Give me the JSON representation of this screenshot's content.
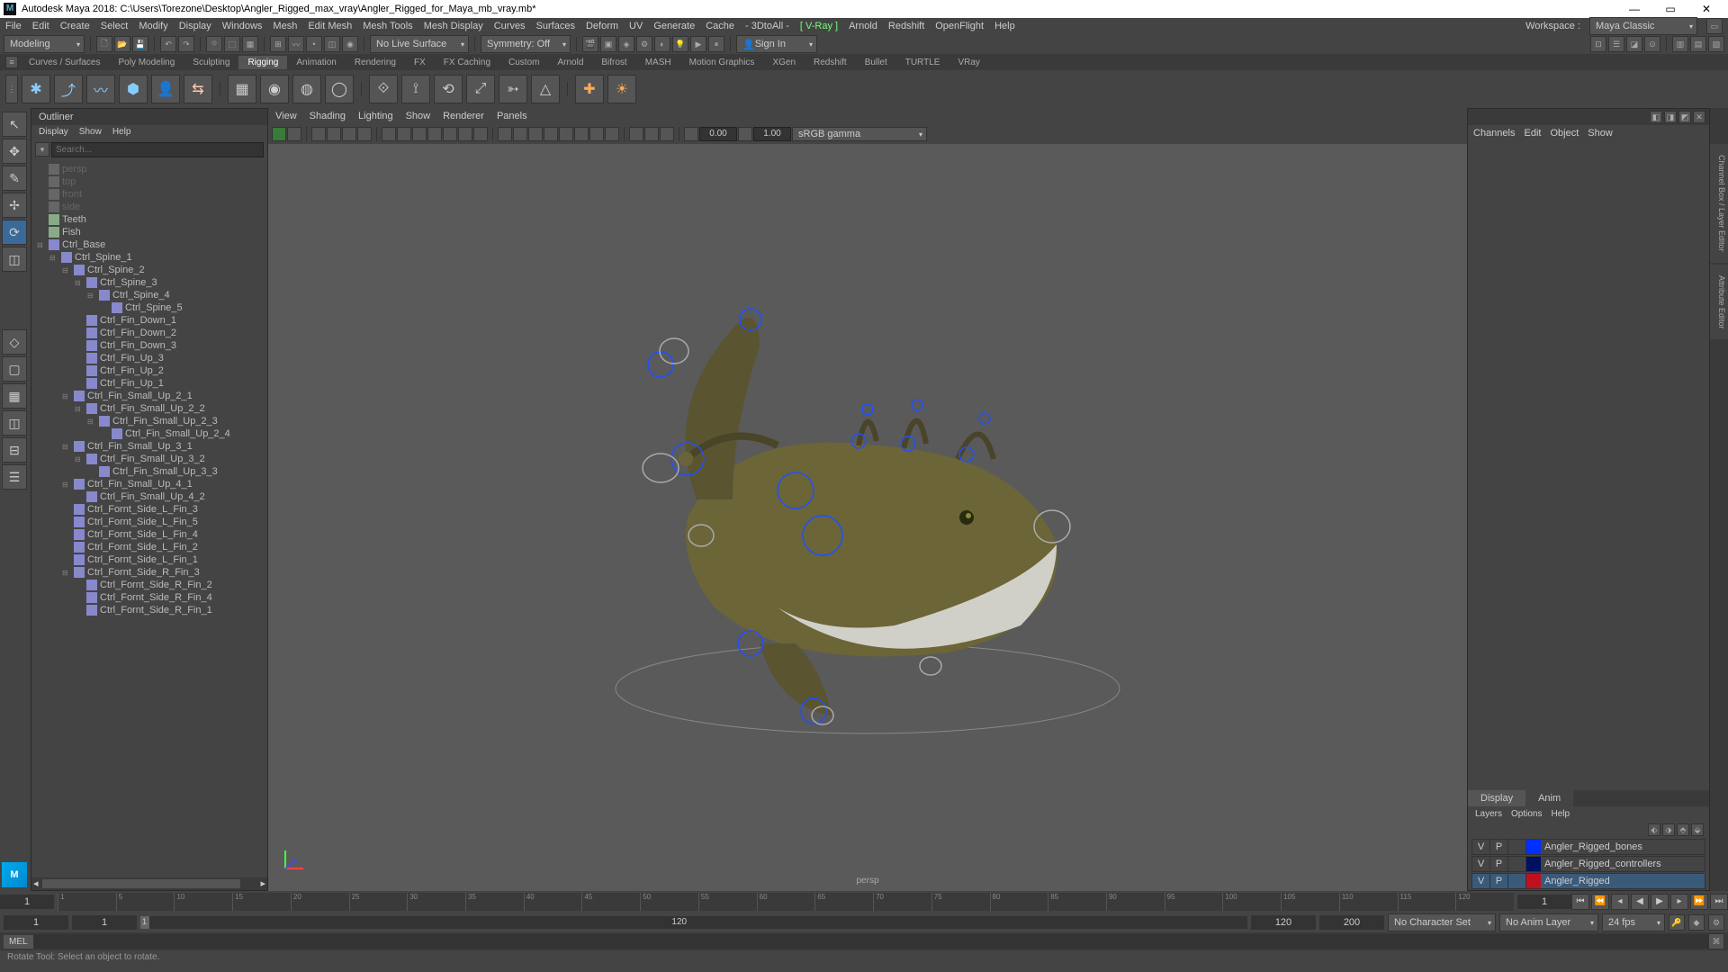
{
  "window": {
    "title": "Autodesk Maya 2018: C:\\Users\\Torezone\\Desktop\\Angler_Rigged_max_vray\\Angler_Rigged_for_Maya_mb_vray.mb*",
    "minimize": "—",
    "maximize": "▭",
    "close": "✕"
  },
  "menus": [
    "File",
    "Edit",
    "Create",
    "Select",
    "Modify",
    "Display",
    "Windows",
    "Mesh",
    "Edit Mesh",
    "Mesh Tools",
    "Mesh Display",
    "Curves",
    "Surfaces",
    "Deform",
    "UV",
    "Generate",
    "Cache",
    "- 3DtoAll -",
    "[ V-Ray ]",
    "Arnold",
    "Redshift",
    "OpenFlight",
    "Help"
  ],
  "workspace": {
    "label": "Workspace :",
    "value": "Maya Classic"
  },
  "statusline": {
    "menuset": "Modeling",
    "nolive": "No Live Surface",
    "symmetry": "Symmetry: Off",
    "signin": "Sign In"
  },
  "shelves": [
    "Curves / Surfaces",
    "Poly Modeling",
    "Sculpting",
    "Rigging",
    "Animation",
    "Rendering",
    "FX",
    "FX Caching",
    "Custom",
    "Arnold",
    "Bifrost",
    "MASH",
    "Motion Graphics",
    "XGen",
    "Redshift",
    "Bullet",
    "TURTLE",
    "VRay"
  ],
  "activeShelf": "Rigging",
  "outliner": {
    "title": "Outliner",
    "menus": [
      "Display",
      "Show",
      "Help"
    ],
    "search": "Search...",
    "items": [
      {
        "d": 0,
        "t": "c",
        "l": "persp",
        "dim": true
      },
      {
        "d": 0,
        "t": "c",
        "l": "top",
        "dim": true
      },
      {
        "d": 0,
        "t": "c",
        "l": "front",
        "dim": true
      },
      {
        "d": 0,
        "t": "c",
        "l": "side",
        "dim": true
      },
      {
        "d": 0,
        "t": "m",
        "l": "Teeth"
      },
      {
        "d": 0,
        "t": "m",
        "l": "Fish"
      },
      {
        "d": 0,
        "t": "x",
        "l": "Ctrl_Base",
        "exp": true
      },
      {
        "d": 1,
        "t": "x",
        "l": "Ctrl_Spine_1",
        "exp": true
      },
      {
        "d": 2,
        "t": "x",
        "l": "Ctrl_Spine_2",
        "exp": true
      },
      {
        "d": 3,
        "t": "x",
        "l": "Ctrl_Spine_3",
        "exp": true
      },
      {
        "d": 4,
        "t": "x",
        "l": "Ctrl_Spine_4",
        "exp": true
      },
      {
        "d": 5,
        "t": "x",
        "l": "Ctrl_Spine_5"
      },
      {
        "d": 3,
        "t": "x",
        "l": "Ctrl_Fin_Down_1"
      },
      {
        "d": 3,
        "t": "x",
        "l": "Ctrl_Fin_Down_2"
      },
      {
        "d": 3,
        "t": "x",
        "l": "Ctrl_Fin_Down_3"
      },
      {
        "d": 3,
        "t": "x",
        "l": "Ctrl_Fin_Up_3"
      },
      {
        "d": 3,
        "t": "x",
        "l": "Ctrl_Fin_Up_2"
      },
      {
        "d": 3,
        "t": "x",
        "l": "Ctrl_Fin_Up_1"
      },
      {
        "d": 2,
        "t": "x",
        "l": "Ctrl_Fin_Small_Up_2_1",
        "exp": true
      },
      {
        "d": 3,
        "t": "x",
        "l": "Ctrl_Fin_Small_Up_2_2",
        "exp": true
      },
      {
        "d": 4,
        "t": "x",
        "l": "Ctrl_Fin_Small_Up_2_3",
        "exp": true
      },
      {
        "d": 5,
        "t": "x",
        "l": "Ctrl_Fin_Small_Up_2_4"
      },
      {
        "d": 2,
        "t": "x",
        "l": "Ctrl_Fin_Small_Up_3_1",
        "exp": true
      },
      {
        "d": 3,
        "t": "x",
        "l": "Ctrl_Fin_Small_Up_3_2",
        "exp": true
      },
      {
        "d": 4,
        "t": "x",
        "l": "Ctrl_Fin_Small_Up_3_3"
      },
      {
        "d": 2,
        "t": "x",
        "l": "Ctrl_Fin_Small_Up_4_1",
        "exp": true
      },
      {
        "d": 3,
        "t": "x",
        "l": "Ctrl_Fin_Small_Up_4_2"
      },
      {
        "d": 2,
        "t": "x",
        "l": "Ctrl_Fornt_Side_L_Fin_3"
      },
      {
        "d": 2,
        "t": "x",
        "l": "Ctrl_Fornt_Side_L_Fin_5"
      },
      {
        "d": 2,
        "t": "x",
        "l": "Ctrl_Fornt_Side_L_Fin_4"
      },
      {
        "d": 2,
        "t": "x",
        "l": "Ctrl_Fornt_Side_L_Fin_2"
      },
      {
        "d": 2,
        "t": "x",
        "l": "Ctrl_Fornt_Side_L_Fin_1"
      },
      {
        "d": 2,
        "t": "x",
        "l": "Ctrl_Fornt_Side_R_Fin_3",
        "exp": true
      },
      {
        "d": 3,
        "t": "x",
        "l": "Ctrl_Fornt_Side_R_Fin_2"
      },
      {
        "d": 3,
        "t": "x",
        "l": "Ctrl_Fornt_Side_R_Fin_4"
      },
      {
        "d": 3,
        "t": "x",
        "l": "Ctrl_Fornt_Side_R_Fin_1"
      }
    ]
  },
  "viewportPanel": {
    "menus": [
      "View",
      "Shading",
      "Lighting",
      "Show",
      "Renderer",
      "Panels"
    ],
    "field1": "0.00",
    "field2": "1.00",
    "gamma": "sRGB gamma",
    "camLabel": "persp"
  },
  "channelBox": {
    "menus": [
      "Channels",
      "Edit",
      "Object",
      "Show"
    ],
    "displayTab": "Display",
    "animTab": "Anim",
    "layerMenus": [
      "Layers",
      "Options",
      "Help"
    ],
    "layers": [
      {
        "v": "V",
        "p": "P",
        "color": "#0030ff",
        "name": "Angler_Rigged_bones",
        "sel": false
      },
      {
        "v": "V",
        "p": "P",
        "color": "#001060",
        "name": "Angler_Rigged_controllers",
        "sel": false
      },
      {
        "v": "V",
        "p": "P",
        "color": "#c01020",
        "name": "Angler_Rigged",
        "sel": true
      }
    ]
  },
  "timeline": {
    "ticks": [
      "1",
      "5",
      "10",
      "15",
      "20",
      "25",
      "30",
      "35",
      "40",
      "45",
      "50",
      "55",
      "60",
      "65",
      "70",
      "75",
      "80",
      "85",
      "90",
      "95",
      "100",
      "105",
      "110",
      "115",
      "120"
    ],
    "current": "1",
    "rangeStart": "1",
    "rangeStartInner": "1",
    "rangeEnd": "120",
    "rangeEndOuter": "200",
    "noCharSet": "No Character Set",
    "noAnimLayer": "No Anim Layer",
    "fps": "24 fps"
  },
  "commandLine": {
    "label": "MEL"
  },
  "helpLine": "Rotate Tool: Select an object to rotate."
}
